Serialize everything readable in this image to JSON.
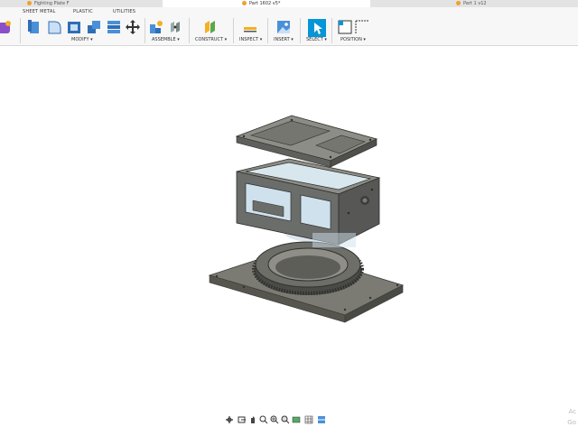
{
  "document_tabs": [
    {
      "label": "Fighting Plate F"
    },
    {
      "label": "Part 1602 v5*"
    },
    {
      "label": "Part 1 v12"
    }
  ],
  "ribbon_tabs": [
    "SHEET METAL",
    "PLASTIC",
    "UTILITIES"
  ],
  "groups": {
    "modify": "MODIFY ▾",
    "assemble": "ASSEMBLE ▾",
    "construct": "CONSTRUCT ▾",
    "inspect": "INSPECT ▾",
    "insert": "INSERT ▾",
    "select": "SELECT ▾",
    "position": "POSITION ▾"
  },
  "icons": {
    "solid_create": "solid-create-icon",
    "press_pull": "press-pull-icon",
    "fillet": "fillet-icon",
    "shell": "shell-icon",
    "combine": "combine-icon",
    "align": "align-icon",
    "move": "move-icon",
    "new_component": "new-component-icon",
    "joint": "joint-icon",
    "offset_plane": "offset-plane-icon",
    "measure": "measure-icon",
    "insert_image": "insert-image-icon",
    "select": "select-icon",
    "position": "position-icon"
  },
  "watermark": {
    "line1": "Ac",
    "line2": "Go"
  },
  "colors": {
    "accent": "#0696d7",
    "model_gray": "#6b6d6b"
  }
}
